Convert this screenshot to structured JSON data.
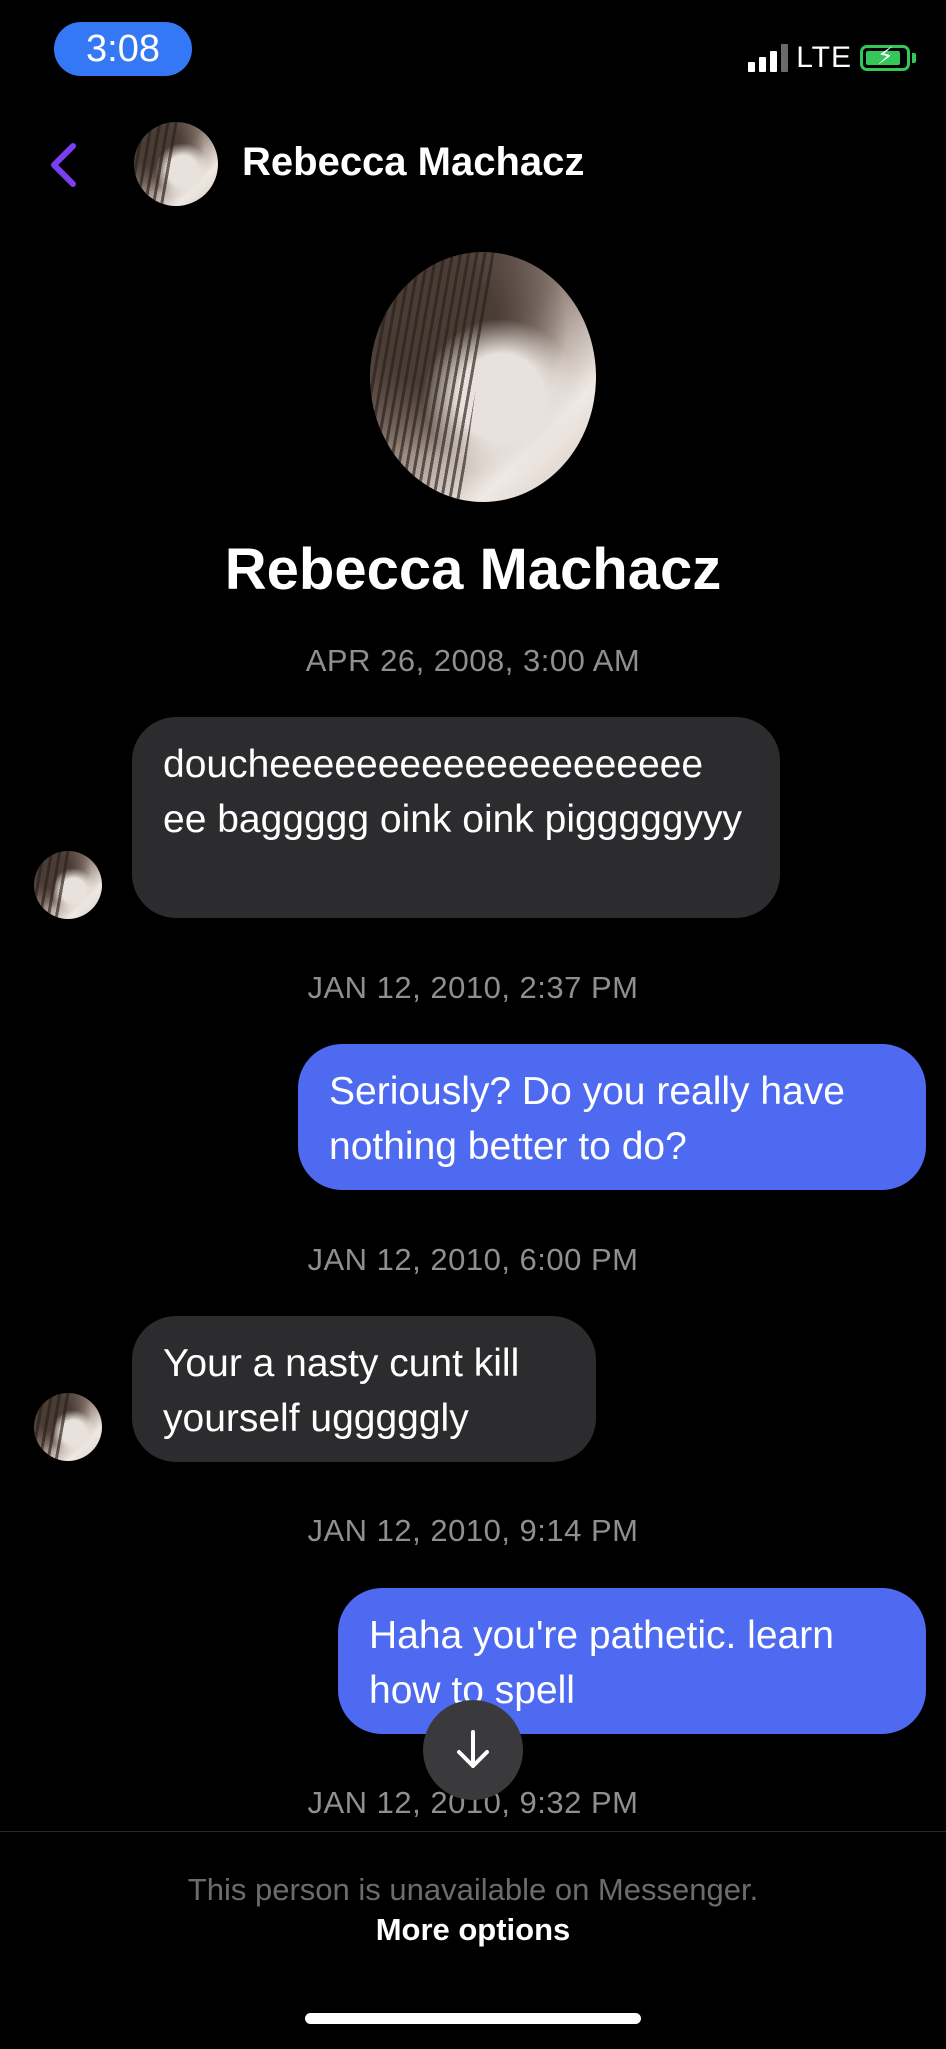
{
  "status_bar": {
    "time": "3:08",
    "network": "LTE",
    "battery_charging": true
  },
  "header": {
    "contact_name": "Rebecca Machacz",
    "back_icon": "chevron-left-icon"
  },
  "profile": {
    "name": "Rebecca Machacz"
  },
  "messages": [
    {
      "timestamp": "APR 26, 2008, 3:00 AM",
      "direction": "incoming",
      "text": "doucheeeeeeeeeeeeeeeeeeee ee baggggg oink oink pigggggyyy"
    },
    {
      "timestamp": "JAN 12, 2010, 2:37 PM",
      "direction": "outgoing",
      "text": "Seriously? Do you really have nothing better to do?"
    },
    {
      "timestamp": "JAN 12, 2010, 6:00 PM",
      "direction": "incoming",
      "text": "Your a nasty cunt kill yourself ugggggly"
    },
    {
      "timestamp": "JAN 12, 2010, 9:14 PM",
      "direction": "outgoing",
      "text": "Haha you're pathetic. learn how to spell"
    },
    {
      "timestamp": "JAN 12, 2010, 9:32 PM"
    }
  ],
  "footer": {
    "unavailable_text": "This person is unavailable on Messenger.",
    "more_options": "More options"
  },
  "colors": {
    "outgoing_bubble": "#4e6af0",
    "incoming_bubble": "#2c2c2e",
    "accent_back": "#7b3ff2",
    "time_pill": "#3478f6"
  }
}
